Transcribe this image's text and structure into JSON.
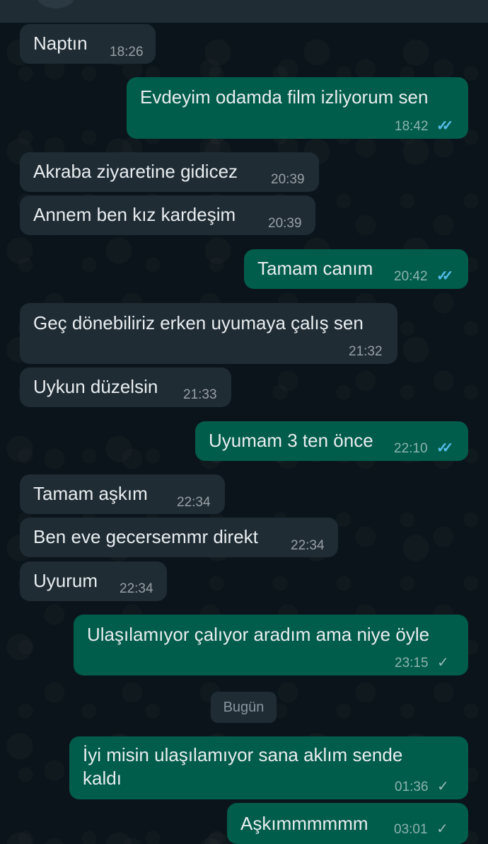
{
  "messages": [
    {
      "dir": "in",
      "text": "Naptın",
      "time": "18:26"
    },
    {
      "dir": "out",
      "text": "Evdeyim odamda film izliyorum sen",
      "time": "18:42",
      "status": "read"
    },
    {
      "dir": "in",
      "text": "Akraba ziyaretine gidicez",
      "time": "20:39"
    },
    {
      "dir": "in",
      "text": "Annem ben kız kardeşim",
      "time": "20:39"
    },
    {
      "dir": "out",
      "text": "Tamam canım",
      "time": "20:42",
      "status": "read"
    },
    {
      "dir": "in",
      "text": "Geç dönebiliriz erken uyumaya çalış sen",
      "time": "21:32"
    },
    {
      "dir": "in",
      "text": "Uykun düzelsin",
      "time": "21:33"
    },
    {
      "dir": "out",
      "text": "Uyumam 3 ten önce",
      "time": "22:10",
      "status": "read"
    },
    {
      "dir": "in",
      "text": "Tamam aşkım",
      "time": "22:34"
    },
    {
      "dir": "in",
      "text": "Ben eve gecersemmr direkt",
      "time": "22:34"
    },
    {
      "dir": "in",
      "text": "Uyurum",
      "time": "22:34"
    },
    {
      "dir": "out",
      "text": "Ulaşılamıyor çalıyor aradım ama niye öyle",
      "time": "23:15",
      "status": "sent"
    },
    {
      "dir": "out",
      "text": "İyi misin ulaşılamıyor sana aklım sende\nkaldı",
      "time": "01:36",
      "status": "sent"
    },
    {
      "dir": "out",
      "text": "Aşkımmmmmm",
      "time": "03:01",
      "status": "sent"
    }
  ],
  "date_separator": "Bugün",
  "icons": {
    "read": "double-check-icon",
    "sent": "single-check-icon"
  },
  "colors": {
    "background": "#0b141a",
    "incoming_bubble": "#1f2c34",
    "outgoing_bubble": "#005c4b",
    "read_tick": "#53bdeb"
  }
}
